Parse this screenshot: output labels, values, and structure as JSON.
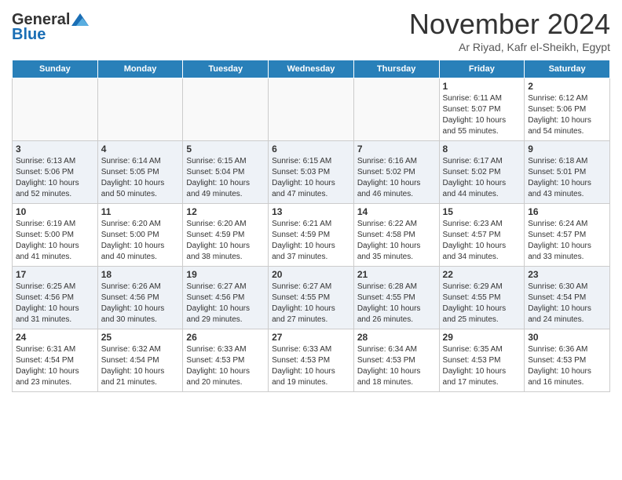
{
  "header": {
    "logo_general": "General",
    "logo_blue": "Blue",
    "month_title": "November 2024",
    "subtitle": "Ar Riyad, Kafr el-Sheikh, Egypt"
  },
  "days_of_week": [
    "Sunday",
    "Monday",
    "Tuesday",
    "Wednesday",
    "Thursday",
    "Friday",
    "Saturday"
  ],
  "weeks": [
    [
      {
        "day": "",
        "info": ""
      },
      {
        "day": "",
        "info": ""
      },
      {
        "day": "",
        "info": ""
      },
      {
        "day": "",
        "info": ""
      },
      {
        "day": "",
        "info": ""
      },
      {
        "day": "1",
        "info": "Sunrise: 6:11 AM\nSunset: 5:07 PM\nDaylight: 10 hours\nand 55 minutes."
      },
      {
        "day": "2",
        "info": "Sunrise: 6:12 AM\nSunset: 5:06 PM\nDaylight: 10 hours\nand 54 minutes."
      }
    ],
    [
      {
        "day": "3",
        "info": "Sunrise: 6:13 AM\nSunset: 5:06 PM\nDaylight: 10 hours\nand 52 minutes."
      },
      {
        "day": "4",
        "info": "Sunrise: 6:14 AM\nSunset: 5:05 PM\nDaylight: 10 hours\nand 50 minutes."
      },
      {
        "day": "5",
        "info": "Sunrise: 6:15 AM\nSunset: 5:04 PM\nDaylight: 10 hours\nand 49 minutes."
      },
      {
        "day": "6",
        "info": "Sunrise: 6:15 AM\nSunset: 5:03 PM\nDaylight: 10 hours\nand 47 minutes."
      },
      {
        "day": "7",
        "info": "Sunrise: 6:16 AM\nSunset: 5:02 PM\nDaylight: 10 hours\nand 46 minutes."
      },
      {
        "day": "8",
        "info": "Sunrise: 6:17 AM\nSunset: 5:02 PM\nDaylight: 10 hours\nand 44 minutes."
      },
      {
        "day": "9",
        "info": "Sunrise: 6:18 AM\nSunset: 5:01 PM\nDaylight: 10 hours\nand 43 minutes."
      }
    ],
    [
      {
        "day": "10",
        "info": "Sunrise: 6:19 AM\nSunset: 5:00 PM\nDaylight: 10 hours\nand 41 minutes."
      },
      {
        "day": "11",
        "info": "Sunrise: 6:20 AM\nSunset: 5:00 PM\nDaylight: 10 hours\nand 40 minutes."
      },
      {
        "day": "12",
        "info": "Sunrise: 6:20 AM\nSunset: 4:59 PM\nDaylight: 10 hours\nand 38 minutes."
      },
      {
        "day": "13",
        "info": "Sunrise: 6:21 AM\nSunset: 4:59 PM\nDaylight: 10 hours\nand 37 minutes."
      },
      {
        "day": "14",
        "info": "Sunrise: 6:22 AM\nSunset: 4:58 PM\nDaylight: 10 hours\nand 35 minutes."
      },
      {
        "day": "15",
        "info": "Sunrise: 6:23 AM\nSunset: 4:57 PM\nDaylight: 10 hours\nand 34 minutes."
      },
      {
        "day": "16",
        "info": "Sunrise: 6:24 AM\nSunset: 4:57 PM\nDaylight: 10 hours\nand 33 minutes."
      }
    ],
    [
      {
        "day": "17",
        "info": "Sunrise: 6:25 AM\nSunset: 4:56 PM\nDaylight: 10 hours\nand 31 minutes."
      },
      {
        "day": "18",
        "info": "Sunrise: 6:26 AM\nSunset: 4:56 PM\nDaylight: 10 hours\nand 30 minutes."
      },
      {
        "day": "19",
        "info": "Sunrise: 6:27 AM\nSunset: 4:56 PM\nDaylight: 10 hours\nand 29 minutes."
      },
      {
        "day": "20",
        "info": "Sunrise: 6:27 AM\nSunset: 4:55 PM\nDaylight: 10 hours\nand 27 minutes."
      },
      {
        "day": "21",
        "info": "Sunrise: 6:28 AM\nSunset: 4:55 PM\nDaylight: 10 hours\nand 26 minutes."
      },
      {
        "day": "22",
        "info": "Sunrise: 6:29 AM\nSunset: 4:55 PM\nDaylight: 10 hours\nand 25 minutes."
      },
      {
        "day": "23",
        "info": "Sunrise: 6:30 AM\nSunset: 4:54 PM\nDaylight: 10 hours\nand 24 minutes."
      }
    ],
    [
      {
        "day": "24",
        "info": "Sunrise: 6:31 AM\nSunset: 4:54 PM\nDaylight: 10 hours\nand 23 minutes."
      },
      {
        "day": "25",
        "info": "Sunrise: 6:32 AM\nSunset: 4:54 PM\nDaylight: 10 hours\nand 21 minutes."
      },
      {
        "day": "26",
        "info": "Sunrise: 6:33 AM\nSunset: 4:53 PM\nDaylight: 10 hours\nand 20 minutes."
      },
      {
        "day": "27",
        "info": "Sunrise: 6:33 AM\nSunset: 4:53 PM\nDaylight: 10 hours\nand 19 minutes."
      },
      {
        "day": "28",
        "info": "Sunrise: 6:34 AM\nSunset: 4:53 PM\nDaylight: 10 hours\nand 18 minutes."
      },
      {
        "day": "29",
        "info": "Sunrise: 6:35 AM\nSunset: 4:53 PM\nDaylight: 10 hours\nand 17 minutes."
      },
      {
        "day": "30",
        "info": "Sunrise: 6:36 AM\nSunset: 4:53 PM\nDaylight: 10 hours\nand 16 minutes."
      }
    ]
  ]
}
